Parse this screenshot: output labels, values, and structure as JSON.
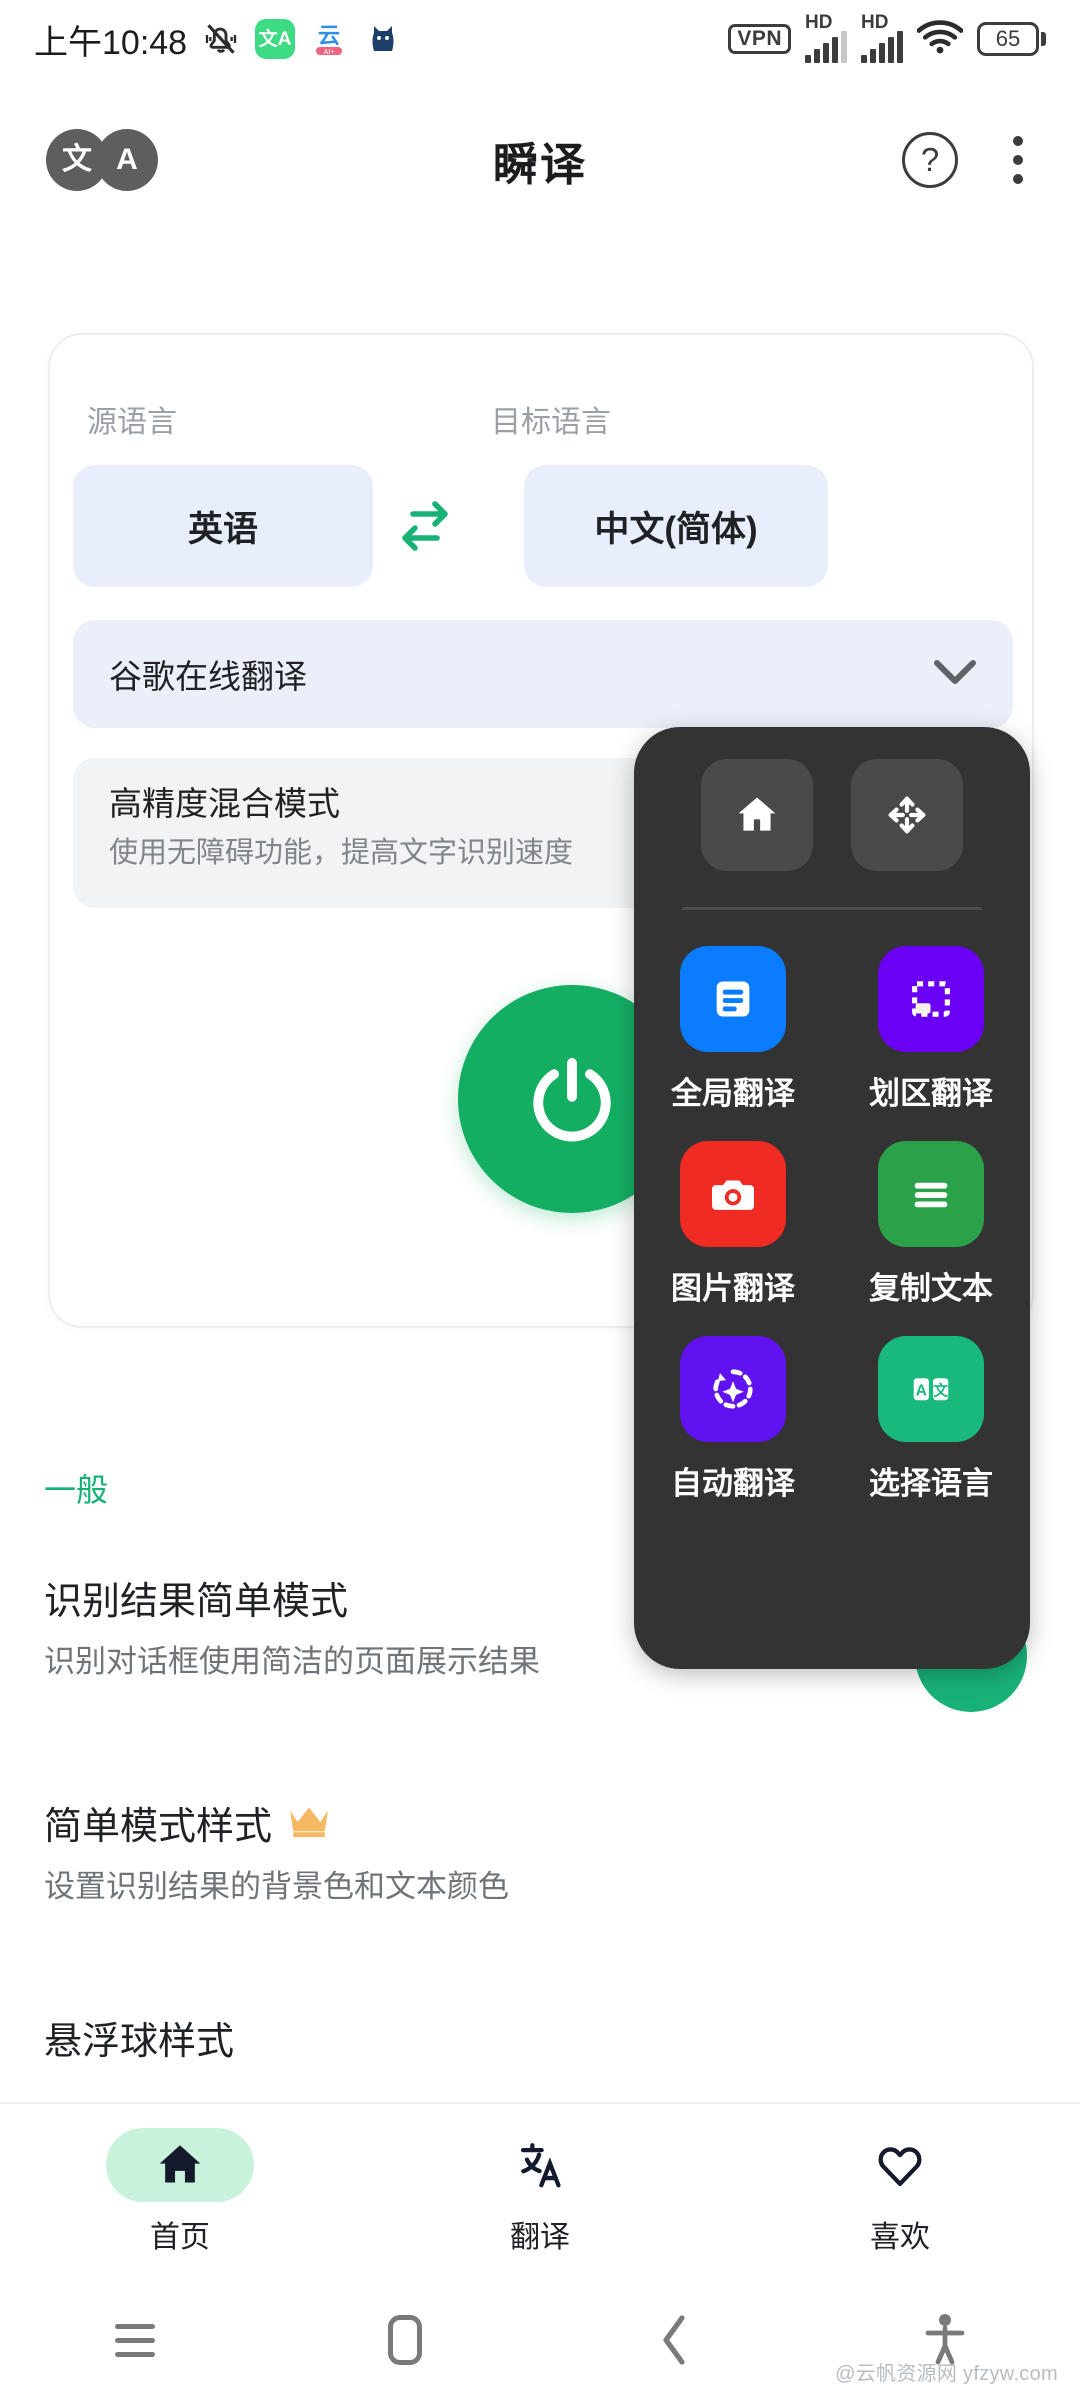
{
  "statusbar": {
    "time": "上午10:48",
    "silent_icon": "bell-muted-icon",
    "app_icons": [
      {
        "name": "translate-app-icon",
        "glyph": "文A"
      },
      {
        "name": "yun-app-icon",
        "glyph": "云"
      },
      {
        "name": "cat-app-icon",
        "glyph": "猫"
      }
    ],
    "vpn_label": "VPN",
    "signal_label": "HD",
    "battery_level": "65"
  },
  "appbar": {
    "logo_left": "文",
    "logo_right": "A",
    "title": "瞬译",
    "help_glyph": "?",
    "menu_icon": "kebab-menu-icon"
  },
  "card": {
    "source_label": "源语言",
    "target_label": "目标语言",
    "source_language": "英语",
    "target_language": "中文(简体)",
    "swap_icon": "swap-arrows-icon",
    "engine": "谷歌在线翻译",
    "engine_chevron": "chevron-down-icon",
    "mode_title": "高精度混合模式",
    "mode_subtitle": "使用无障碍功能，提高文字识别速度",
    "power_icon": "power-icon"
  },
  "settings": {
    "section_title": "一般",
    "items": [
      {
        "title": "识别结果简单模式",
        "subtitle": "识别对话框使用简洁的页面展示结果",
        "badge": ""
      },
      {
        "title": "简单模式样式",
        "subtitle": "设置识别结果的背景色和文本颜色",
        "badge": "👑"
      },
      {
        "title": "悬浮球样式",
        "subtitle": "",
        "badge": ""
      }
    ]
  },
  "floating_panel": {
    "controls": [
      {
        "name": "home-icon",
        "label": ""
      },
      {
        "name": "move-icon",
        "label": ""
      }
    ],
    "actions": [
      {
        "label": "全局翻译",
        "icon": "document-lines-icon",
        "color": "#0a7cff"
      },
      {
        "label": "划区翻译",
        "icon": "dashed-selection-icon",
        "color": "#6a00f4"
      },
      {
        "label": "图片翻译",
        "icon": "camera-icon",
        "color": "#ef2b24"
      },
      {
        "label": "复制文本",
        "icon": "text-lines-icon",
        "color": "#2ba14a"
      },
      {
        "label": "自动翻译",
        "icon": "auto-refresh-sparkle-icon",
        "color": "#6112f0"
      },
      {
        "label": "选择语言",
        "icon": "language-ab-icon",
        "color": "#19b97e"
      }
    ]
  },
  "bottomnav": {
    "items": [
      {
        "label": "首页",
        "icon": "home-icon",
        "active": true
      },
      {
        "label": "翻译",
        "icon": "translate-icon",
        "active": false
      },
      {
        "label": "喜欢",
        "icon": "heart-icon",
        "active": false
      }
    ]
  },
  "sysnav": {
    "items": [
      "recents-icon",
      "home-icon",
      "back-icon",
      "accessibility-icon"
    ]
  },
  "watermark": "@云帆资源网 yfzyw.com",
  "colors": {
    "accent_green": "#14ae63",
    "section_green": "#18b277",
    "pill_blue": "#e8eefb",
    "panel_dark": "#333333"
  }
}
